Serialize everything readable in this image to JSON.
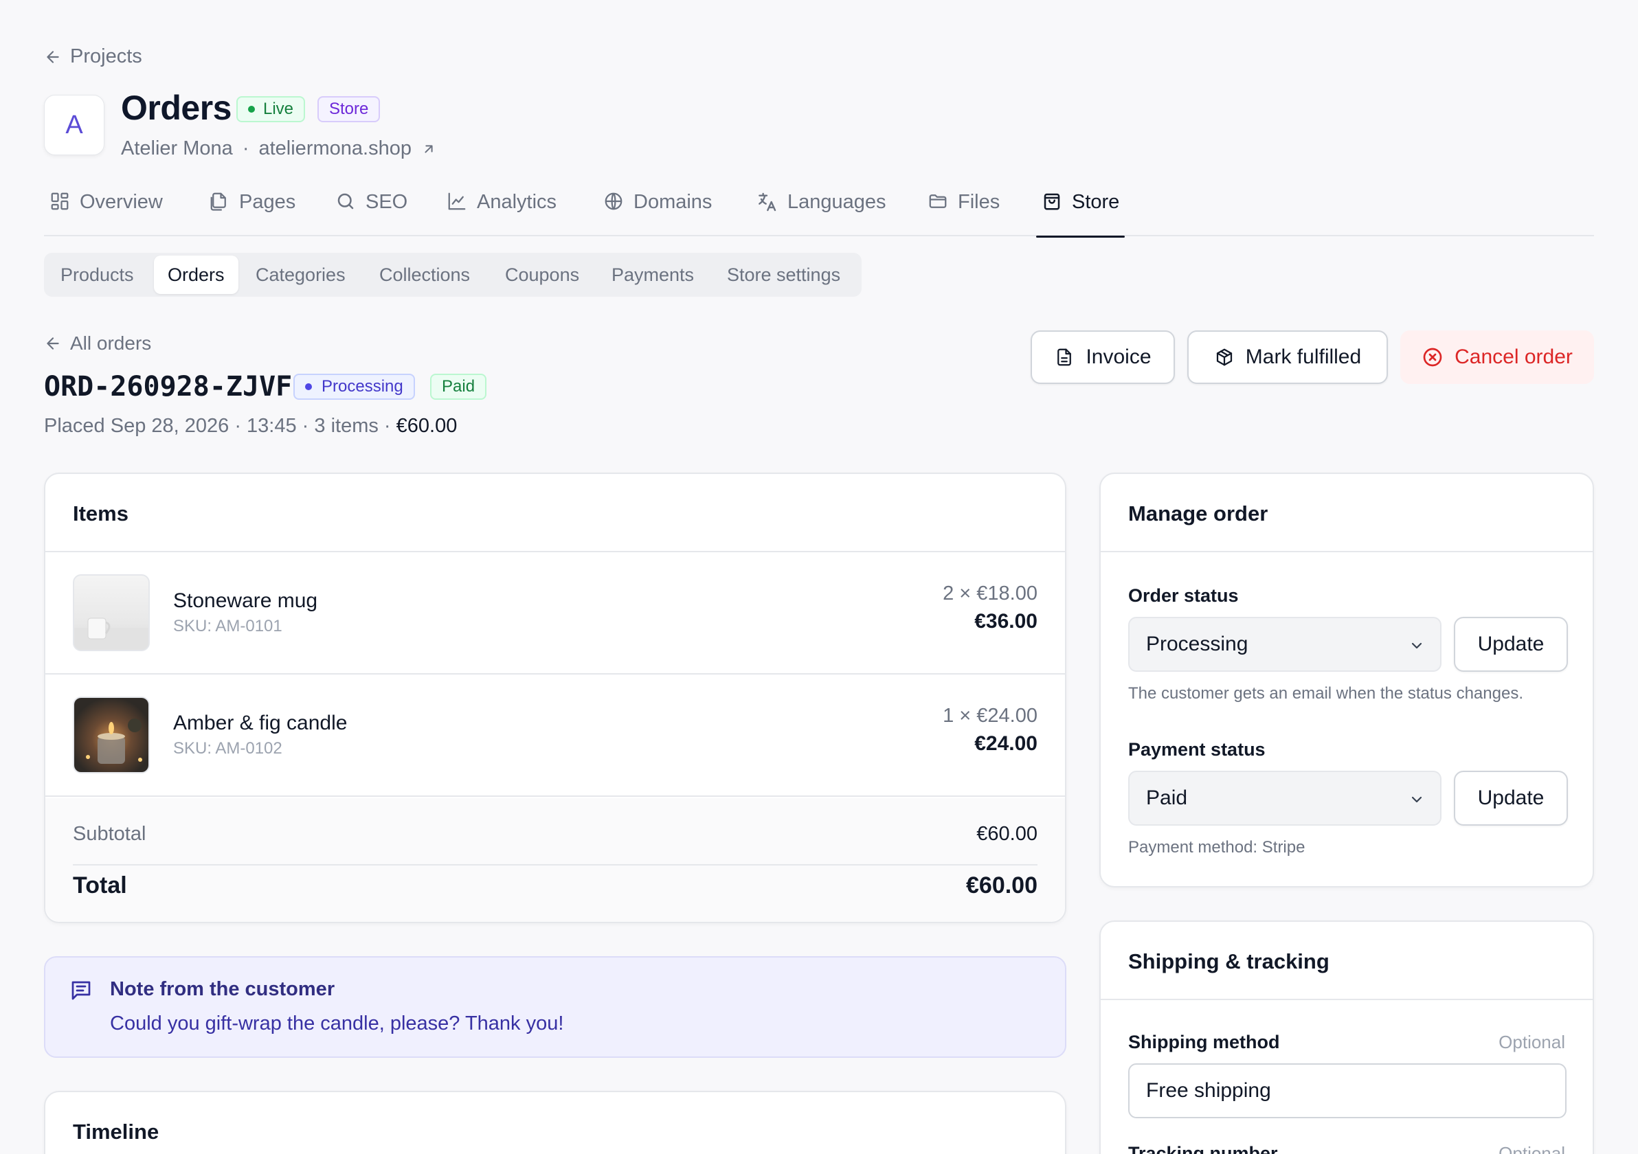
{
  "nav": {
    "back_label": "Projects"
  },
  "project": {
    "avatar_letter": "A",
    "title": "Orders",
    "badges": {
      "live": "Live",
      "store": "Store"
    },
    "name": "Atelier Mona",
    "separator": "·",
    "domain": "ateliermona.shop"
  },
  "tabs": [
    {
      "label": "Overview",
      "icon": "grid-icon"
    },
    {
      "label": "Pages",
      "icon": "pages-icon"
    },
    {
      "label": "SEO",
      "icon": "search-icon"
    },
    {
      "label": "Analytics",
      "icon": "line-chart-icon"
    },
    {
      "label": "Domains",
      "icon": "globe-icon"
    },
    {
      "label": "Languages",
      "icon": "translate-icon"
    },
    {
      "label": "Files",
      "icon": "folder-icon"
    },
    {
      "label": "Store",
      "icon": "shopping-bag-icon",
      "active": true
    }
  ],
  "subtabs": [
    {
      "label": "Products"
    },
    {
      "label": "Orders",
      "active": true
    },
    {
      "label": "Categories"
    },
    {
      "label": "Collections"
    },
    {
      "label": "Coupons"
    },
    {
      "label": "Payments"
    },
    {
      "label": "Store settings"
    }
  ],
  "order": {
    "back_label": "All orders",
    "id": "ORD-260928-ZJVF",
    "status_badge": "Processing",
    "payment_badge": "Paid",
    "placed_text": "Placed Sep 28, 2026 · 13:45 · 3 items · ",
    "placed_total": "€60.00",
    "actions": {
      "invoice": "Invoice",
      "mark_fulfilled": "Mark fulfilled",
      "cancel": "Cancel order"
    }
  },
  "items_card": {
    "title": "Items",
    "items": [
      {
        "name": "Stoneware mug",
        "sku": "SKU: AM-0101",
        "qty_price": "2 × €18.00",
        "total": "€36.00"
      },
      {
        "name": "Amber & fig candle",
        "sku": "SKU: AM-0102",
        "qty_price": "1 × €24.00",
        "total": "€24.00"
      }
    ],
    "subtotal_label": "Subtotal",
    "subtotal_value": "€60.00",
    "total_label": "Total",
    "total_value": "€60.00"
  },
  "note": {
    "title": "Note from the customer",
    "text": "Could you gift-wrap the candle, please? Thank you!"
  },
  "timeline": {
    "title": "Timeline"
  },
  "manage": {
    "title": "Manage order",
    "order_status_label": "Order status",
    "order_status_value": "Processing",
    "update_label": "Update",
    "order_status_help": "The customer gets an email when the status changes.",
    "payment_status_label": "Payment status",
    "payment_status_value": "Paid",
    "payment_help": "Payment method: Stripe"
  },
  "shipping": {
    "title": "Shipping & tracking",
    "method_label": "Shipping method",
    "optional_label": "Optional",
    "method_value": "Free shipping",
    "tracking_label": "Tracking number"
  },
  "colors": {
    "accent": "#5b4bd6",
    "live_green": "#15803d",
    "store_purple": "#6d28d9",
    "processing_indigo": "#4338ca",
    "cancel_red": "#dc2626",
    "note_bg": "#f0f0fe"
  }
}
